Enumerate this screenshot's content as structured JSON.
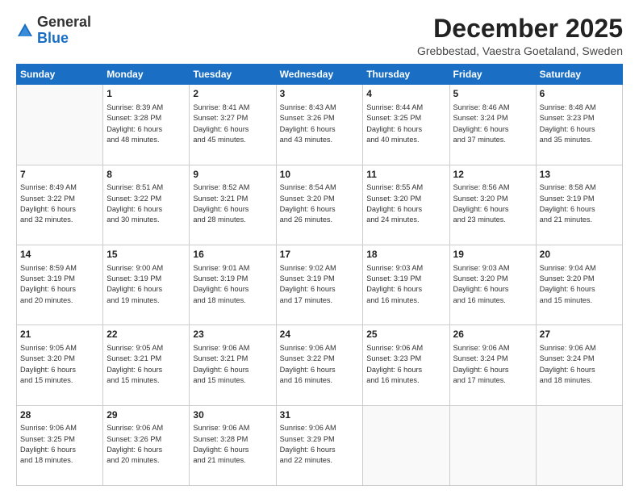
{
  "header": {
    "logo": {
      "general": "General",
      "blue": "Blue"
    },
    "title": "December 2025",
    "location": "Grebbestad, Vaestra Goetaland, Sweden"
  },
  "calendar": {
    "weekdays": [
      "Sunday",
      "Monday",
      "Tuesday",
      "Wednesday",
      "Thursday",
      "Friday",
      "Saturday"
    ],
    "weeks": [
      [
        {
          "day": "",
          "info": ""
        },
        {
          "day": "1",
          "info": "Sunrise: 8:39 AM\nSunset: 3:28 PM\nDaylight: 6 hours\nand 48 minutes."
        },
        {
          "day": "2",
          "info": "Sunrise: 8:41 AM\nSunset: 3:27 PM\nDaylight: 6 hours\nand 45 minutes."
        },
        {
          "day": "3",
          "info": "Sunrise: 8:43 AM\nSunset: 3:26 PM\nDaylight: 6 hours\nand 43 minutes."
        },
        {
          "day": "4",
          "info": "Sunrise: 8:44 AM\nSunset: 3:25 PM\nDaylight: 6 hours\nand 40 minutes."
        },
        {
          "day": "5",
          "info": "Sunrise: 8:46 AM\nSunset: 3:24 PM\nDaylight: 6 hours\nand 37 minutes."
        },
        {
          "day": "6",
          "info": "Sunrise: 8:48 AM\nSunset: 3:23 PM\nDaylight: 6 hours\nand 35 minutes."
        }
      ],
      [
        {
          "day": "7",
          "info": "Sunrise: 8:49 AM\nSunset: 3:22 PM\nDaylight: 6 hours\nand 32 minutes."
        },
        {
          "day": "8",
          "info": "Sunrise: 8:51 AM\nSunset: 3:22 PM\nDaylight: 6 hours\nand 30 minutes."
        },
        {
          "day": "9",
          "info": "Sunrise: 8:52 AM\nSunset: 3:21 PM\nDaylight: 6 hours\nand 28 minutes."
        },
        {
          "day": "10",
          "info": "Sunrise: 8:54 AM\nSunset: 3:20 PM\nDaylight: 6 hours\nand 26 minutes."
        },
        {
          "day": "11",
          "info": "Sunrise: 8:55 AM\nSunset: 3:20 PM\nDaylight: 6 hours\nand 24 minutes."
        },
        {
          "day": "12",
          "info": "Sunrise: 8:56 AM\nSunset: 3:20 PM\nDaylight: 6 hours\nand 23 minutes."
        },
        {
          "day": "13",
          "info": "Sunrise: 8:58 AM\nSunset: 3:19 PM\nDaylight: 6 hours\nand 21 minutes."
        }
      ],
      [
        {
          "day": "14",
          "info": "Sunrise: 8:59 AM\nSunset: 3:19 PM\nDaylight: 6 hours\nand 20 minutes."
        },
        {
          "day": "15",
          "info": "Sunrise: 9:00 AM\nSunset: 3:19 PM\nDaylight: 6 hours\nand 19 minutes."
        },
        {
          "day": "16",
          "info": "Sunrise: 9:01 AM\nSunset: 3:19 PM\nDaylight: 6 hours\nand 18 minutes."
        },
        {
          "day": "17",
          "info": "Sunrise: 9:02 AM\nSunset: 3:19 PM\nDaylight: 6 hours\nand 17 minutes."
        },
        {
          "day": "18",
          "info": "Sunrise: 9:03 AM\nSunset: 3:19 PM\nDaylight: 6 hours\nand 16 minutes."
        },
        {
          "day": "19",
          "info": "Sunrise: 9:03 AM\nSunset: 3:20 PM\nDaylight: 6 hours\nand 16 minutes."
        },
        {
          "day": "20",
          "info": "Sunrise: 9:04 AM\nSunset: 3:20 PM\nDaylight: 6 hours\nand 15 minutes."
        }
      ],
      [
        {
          "day": "21",
          "info": "Sunrise: 9:05 AM\nSunset: 3:20 PM\nDaylight: 6 hours\nand 15 minutes."
        },
        {
          "day": "22",
          "info": "Sunrise: 9:05 AM\nSunset: 3:21 PM\nDaylight: 6 hours\nand 15 minutes."
        },
        {
          "day": "23",
          "info": "Sunrise: 9:06 AM\nSunset: 3:21 PM\nDaylight: 6 hours\nand 15 minutes."
        },
        {
          "day": "24",
          "info": "Sunrise: 9:06 AM\nSunset: 3:22 PM\nDaylight: 6 hours\nand 16 minutes."
        },
        {
          "day": "25",
          "info": "Sunrise: 9:06 AM\nSunset: 3:23 PM\nDaylight: 6 hours\nand 16 minutes."
        },
        {
          "day": "26",
          "info": "Sunrise: 9:06 AM\nSunset: 3:24 PM\nDaylight: 6 hours\nand 17 minutes."
        },
        {
          "day": "27",
          "info": "Sunrise: 9:06 AM\nSunset: 3:24 PM\nDaylight: 6 hours\nand 18 minutes."
        }
      ],
      [
        {
          "day": "28",
          "info": "Sunrise: 9:06 AM\nSunset: 3:25 PM\nDaylight: 6 hours\nand 18 minutes."
        },
        {
          "day": "29",
          "info": "Sunrise: 9:06 AM\nSunset: 3:26 PM\nDaylight: 6 hours\nand 20 minutes."
        },
        {
          "day": "30",
          "info": "Sunrise: 9:06 AM\nSunset: 3:28 PM\nDaylight: 6 hours\nand 21 minutes."
        },
        {
          "day": "31",
          "info": "Sunrise: 9:06 AM\nSunset: 3:29 PM\nDaylight: 6 hours\nand 22 minutes."
        },
        {
          "day": "",
          "info": ""
        },
        {
          "day": "",
          "info": ""
        },
        {
          "day": "",
          "info": ""
        }
      ]
    ]
  }
}
